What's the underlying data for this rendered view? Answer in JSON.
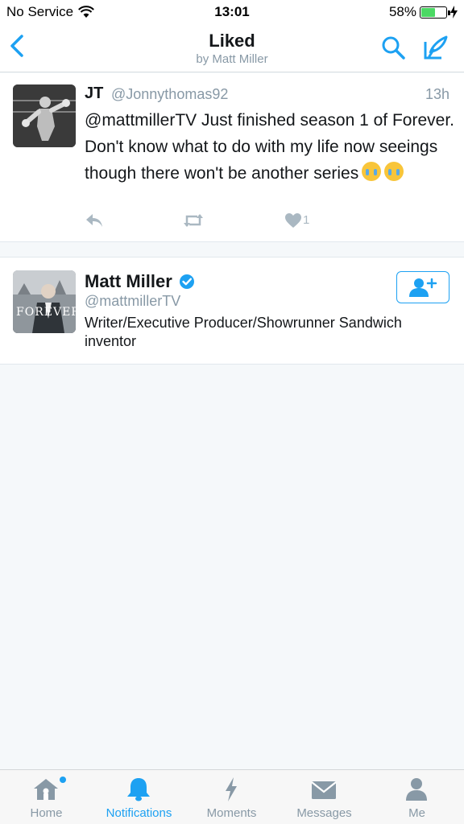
{
  "status": {
    "carrier": "No Service",
    "time": "13:01",
    "battery": "58%",
    "battery_level": 0.58
  },
  "nav": {
    "title": "Liked",
    "subtitle": "by Matt Miller"
  },
  "tweet": {
    "name": "JT",
    "handle": "@Jonnythomas92",
    "time": "13h",
    "text": "@mattmillerTV Just finished season 1 of Forever. Don't know what to do with my life now seeings though there won't be another series",
    "like_count": "1"
  },
  "user": {
    "name": "Matt Miller",
    "handle": "@mattmillerTV",
    "bio": "Writer/Executive Producer/Showrunner Sandwich inventor",
    "avatar_text": "FOREVER"
  },
  "tabs": [
    {
      "label": "Home",
      "icon": "home-icon"
    },
    {
      "label": "Notifications",
      "icon": "bell-icon"
    },
    {
      "label": "Moments",
      "icon": "lightning-icon"
    },
    {
      "label": "Messages",
      "icon": "envelope-icon"
    },
    {
      "label": "Me",
      "icon": "person-icon"
    }
  ],
  "colors": {
    "accent": "#1da1f2",
    "secondary_text": "#8899a6",
    "battery": "#4cd964"
  }
}
